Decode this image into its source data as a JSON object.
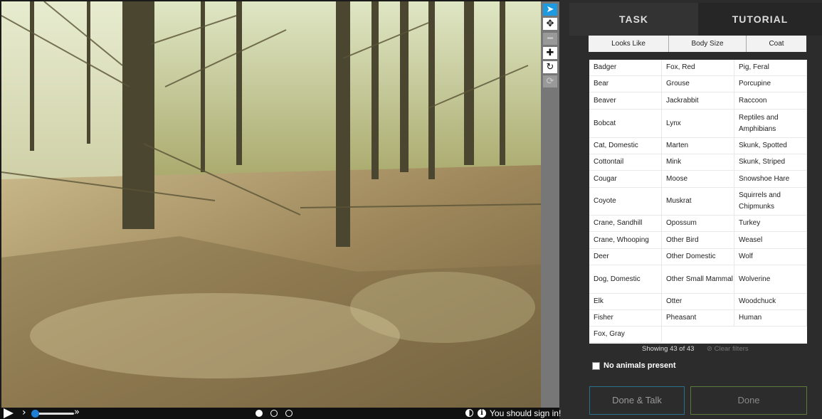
{
  "viewer": {
    "tools": [
      {
        "name": "select-tool",
        "glyph": "➤"
      },
      {
        "name": "move-tool",
        "glyph": "✥"
      },
      {
        "name": "zoom-out-tool",
        "glyph": "━"
      },
      {
        "name": "zoom-in-tool",
        "glyph": "✚"
      },
      {
        "name": "rotate-tool",
        "glyph": "↻"
      },
      {
        "name": "reset-tool",
        "glyph": "⟳"
      }
    ],
    "controls": {
      "step_glyph": "›",
      "fast_glyph": "»",
      "frames": 3,
      "current_frame": 1,
      "info_glyph": "i",
      "signin_text": "You should sign in!"
    }
  },
  "panel": {
    "tabs": {
      "task": "TASK",
      "tutorial": "TUTORIAL"
    },
    "filters": [
      "Looks Like",
      "Body Size",
      "Coat"
    ],
    "species_columns": [
      [
        "Badger",
        "Bear",
        "Beaver",
        "Bobcat",
        "Cat, Domestic",
        "Cottontail",
        "Cougar",
        "Coyote",
        "Crane, Sandhill",
        "Crane, Whooping",
        "Deer",
        "Dog, Domestic",
        "Elk",
        "Fisher",
        "Fox, Gray"
      ],
      [
        "Fox, Red",
        "Grouse",
        "Jackrabbit",
        "Lynx",
        "Marten",
        "Mink",
        "Moose",
        "Muskrat",
        "Opossum",
        "Other Bird",
        "Other Domestic",
        "Other Small Mammal",
        "Otter",
        "Pheasant"
      ],
      [
        "Pig, Feral",
        "Porcupine",
        "Raccoon",
        "Reptiles and Amphibians",
        "Skunk, Spotted",
        "Skunk, Striped",
        "Snowshoe Hare",
        "Squirrels and Chipmunks",
        "Turkey",
        "Weasel",
        "Wolf",
        "Wolverine",
        "Woodchuck",
        "Human"
      ]
    ],
    "showing_text": "Showing 43 of 43",
    "clear_filters": "⊘ Clear filters",
    "no_animals_label": "No animals present",
    "done_talk_label": "Done & Talk",
    "done_label": "Done"
  },
  "colors": {
    "accent": "#1e9ae0",
    "done_talk_border": "#2a6f8c",
    "done_border": "#5d7a3d"
  }
}
